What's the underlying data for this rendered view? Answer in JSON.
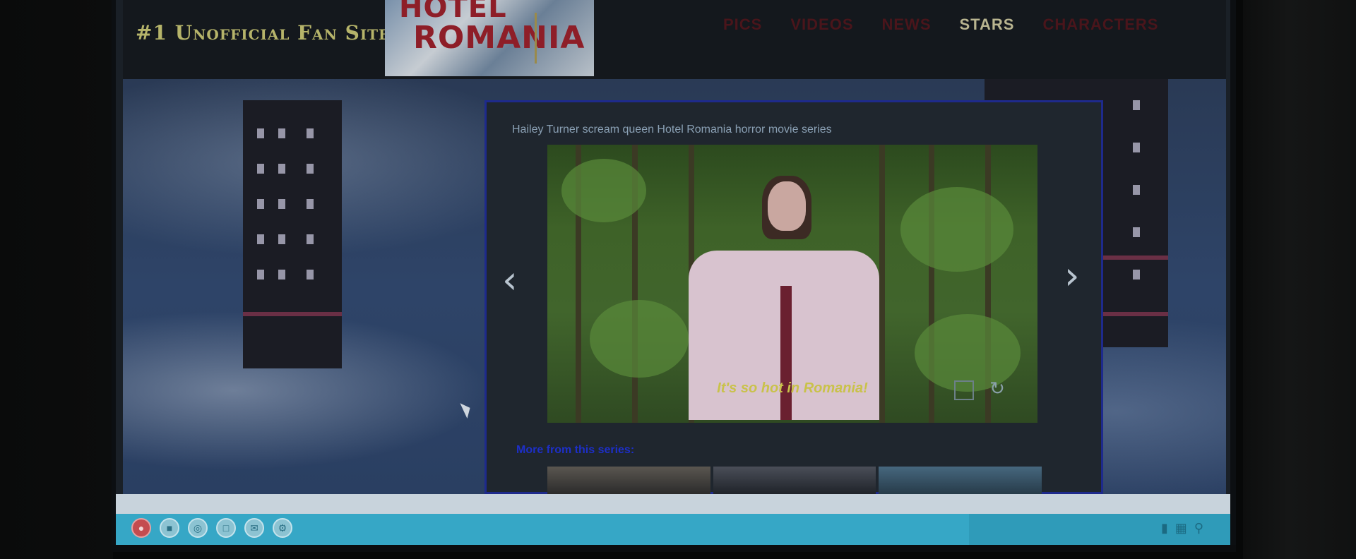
{
  "header": {
    "fan_site": "#1 Unofficial Fan Site",
    "logo_line1": "HOTEL",
    "logo_line2": "ROMANIA",
    "nav": [
      {
        "label": "PICS"
      },
      {
        "label": "VIDEOS"
      },
      {
        "label": "NEWS"
      },
      {
        "label": "STARS",
        "active": true
      },
      {
        "label": "CHARACTERS"
      }
    ]
  },
  "panel": {
    "caption": "Hailey Turner scream queen Hotel Romania horror movie series",
    "subtitle": "It's so hot in Romania!",
    "more_label": "More from this series:",
    "prev_icon": "chevron-left-icon",
    "next_icon": "chevron-right-icon"
  },
  "taskbar": {
    "icons": [
      "start-icon",
      "folder-icon",
      "browser-icon",
      "computer-icon",
      "mail-icon",
      "settings-icon"
    ],
    "tray": [
      "lock-icon",
      "network-icon",
      "search-icon"
    ]
  },
  "colors": {
    "accent_border": "#1e2a8c",
    "taskbar": "#36a7c6",
    "nav_active": "#b9b590",
    "nav_inactive": "#4a151b",
    "subtitle": "#c9c24a"
  }
}
